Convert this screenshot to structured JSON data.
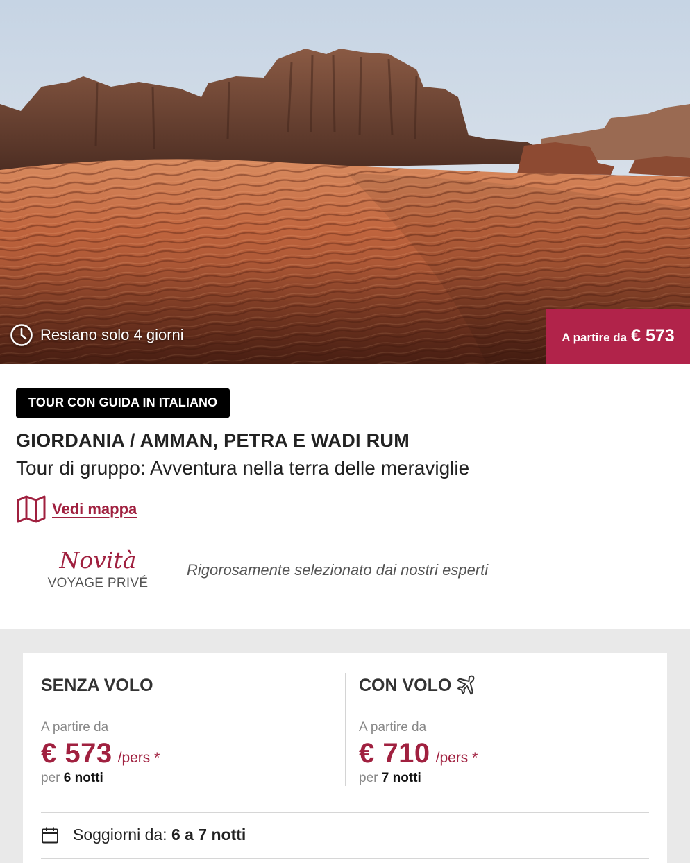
{
  "hero": {
    "image_alt": "Deserto di Wadi Rum con dune rosse e montagne rocciose",
    "countdown_text": "Restano solo 4 giorni",
    "price_label": "A partire da",
    "price_value": "€ 573"
  },
  "info": {
    "tag": "TOUR CON GUIDA IN ITALIANO",
    "title": "GIORDANIA / AMMAN, PETRA E WADI RUM",
    "subtitle": "Tour di gruppo: Avventura nella terra delle meraviglie",
    "map_link": "Vedi mappa",
    "novita_title": "Novità",
    "novita_sub": "VOYAGE PRIVÉ",
    "novita_desc": "Rigorosamente selezionato dai nostri esperti"
  },
  "offers": {
    "without_flight": {
      "title": "SENZA VOLO",
      "from": "A partire da",
      "price": "€ 573",
      "per": "/pers *",
      "nights_prefix": "per",
      "nights": "6 notti"
    },
    "with_flight": {
      "title": "CON VOLO",
      "from": "A partire da",
      "price": "€ 710",
      "per": "/pers *",
      "nights_prefix": "per",
      "nights": "7 notti"
    },
    "stay_label": "Soggiorni da:",
    "stay_value": "6 a 7 notti"
  },
  "colors": {
    "accent": "#a0203f",
    "badge": "#b1234a",
    "tag_bg": "#000000",
    "section_bg": "#e9e9e9"
  },
  "icons": {
    "countdown": "clock-icon",
    "map": "map-icon",
    "flight": "airplane-icon",
    "stay": "calendar-icon"
  }
}
